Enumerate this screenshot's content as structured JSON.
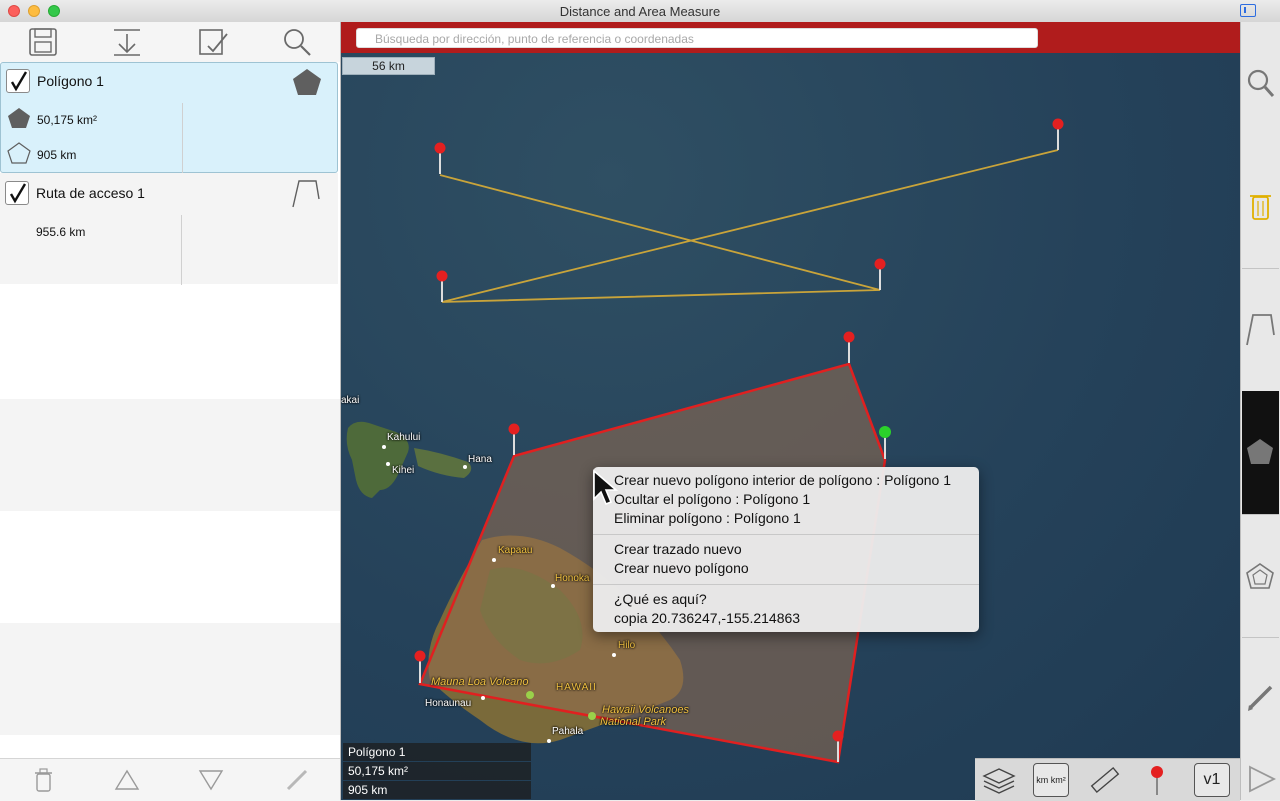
{
  "window": {
    "title": "Distance and Area Measure"
  },
  "toolbar": {
    "icons": [
      "save-icon",
      "import-icon",
      "checklist-icon",
      "search-icon"
    ]
  },
  "items": [
    {
      "title": "Polígono 1",
      "area": "50,175 km²",
      "perimeter": "905 km",
      "checked": true,
      "icon": "pentagon-filled-icon"
    },
    {
      "title": "Ruta de acceso 1",
      "distance": "955.6 km",
      "checked": true,
      "icon": "path-icon"
    }
  ],
  "bottom_toolbar": {
    "icons": [
      "trash-icon",
      "move-up-icon",
      "move-down-icon",
      "edit-icon"
    ]
  },
  "search": {
    "placeholder": "Búsqueda por dirección, punto de referencia o coordenadas"
  },
  "scale_bar": "56 km",
  "map_labels": {
    "kahului": "Kahului",
    "kihei": "Kihei",
    "hana": "Hana",
    "kai": "akai",
    "kapaau": "Kapaau",
    "honoka": "Honoka",
    "hilo": "Hilo",
    "hawaii": "HAWAII",
    "mauna_loa": "Mauna Loa Volcano",
    "honaunau": "Honaunau",
    "volcanoes_1": "Hawaii Volcanoes",
    "volcanoes_2": "National Park",
    "pahala": "Pahala"
  },
  "info_box": {
    "name": "Polígono 1",
    "area": "50,175 km²",
    "perimeter": "905 km"
  },
  "context_menu": {
    "items": [
      "Crear nuevo polígono interior de polígono : Polígono 1",
      "Ocultar el polígono : Polígono 1",
      "Eliminar polígono : Polígono 1",
      "Crear trazado nuevo",
      "Crear nuevo polígono",
      "¿Qué es aquí?",
      "copia 20.736247,-155.214863"
    ]
  },
  "right_toolbar": {
    "icons": [
      "search-icon",
      "trash-icon",
      "path-tool-icon",
      "polygon-filled-tool-icon",
      "polygon-outline-tool-icon",
      "pencil-icon",
      "play-icon"
    ]
  },
  "map_tools": {
    "units_label": "km km²",
    "version_label": "v1",
    "icons": [
      "layers-icon",
      "units-icon",
      "ruler-icon",
      "pin-icon",
      "version-icon"
    ]
  },
  "colors": {
    "header_red": "#b01c1c",
    "selected_item": "#d9f1fb",
    "polygon_stroke": "#e02020",
    "route_stroke": "#c9a43a",
    "pin_red": "#e42020",
    "pin_green": "#2bd12b"
  }
}
